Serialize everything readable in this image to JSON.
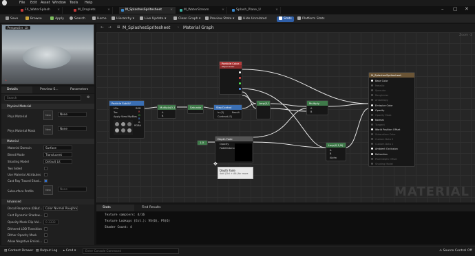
{
  "menu": [
    "File",
    "Edit",
    "Asset",
    "Window",
    "Tools",
    "Help"
  ],
  "doc_tabs": [
    {
      "label": "FX_WaterSplash",
      "color": "#c43a3a"
    },
    {
      "label": "M_Droplets",
      "color": "#c43a3a"
    },
    {
      "label": "M_SplashesSpritesheet",
      "color": "#3a8ad0"
    },
    {
      "label": "M_WaterStream",
      "color": "#3ab0a0"
    },
    {
      "label": "Splash_Plane_U",
      "color": "#3a8ad0"
    }
  ],
  "toolbar": {
    "save": "Save",
    "browse": "Browse",
    "apply": "Apply",
    "search": "Search",
    "home": "Home",
    "hierarchy": "Hierarchy",
    "live_update": "Live Update",
    "clean_graph": "Clean Graph",
    "preview_state": "Preview State",
    "hide_unrelated": "Hide Unrelated",
    "stats": "Stats",
    "platform_stats": "Platform Stats"
  },
  "viewport": {
    "perspective": "Perspective",
    "lit": "Lit"
  },
  "left_tabs": {
    "details": "Details",
    "preview": "Preview S...",
    "parameters": "Parameters"
  },
  "details": {
    "search_placeholder": "Search",
    "physical_material": "Physical Material",
    "phys_material": {
      "label": "Phys Material",
      "value": "None"
    },
    "phys_material_mask": {
      "label": "Phys Material Mask",
      "value": "None"
    },
    "material": "Material",
    "material_domain": {
      "label": "Material Domain",
      "value": "Surface"
    },
    "blend_mode": {
      "label": "Blend Mode",
      "value": "Translucent"
    },
    "shading_model": {
      "label": "Shading Model",
      "value": "Default Lit"
    },
    "two_sided": "Two Sided",
    "use_material_attributes": "Use Material Attributes",
    "cast_ray_traced": "Cast Ray Traced Shad...",
    "subsurface_profile": {
      "label": "Subsurface Profile",
      "value": "None"
    },
    "advanced": "Advanced",
    "decal_response": {
      "label": "Decal Response (DBuf...",
      "value": "Color Normal Roughness"
    },
    "cast_dynamic": "Cast Dynamic Shadow...",
    "opacity_mask_clip": {
      "label": "Opacity Mask Clip Val...",
      "value": "0.3333"
    },
    "dithered_lod": "Dithered LOD Transition",
    "dither_opacity": "Dither Opacity Mask",
    "allow_negative": "Allow Negative Emissi...",
    "thumb_label": "New"
  },
  "graph": {
    "breadcrumb_root": "M_SplashesSpritesheet",
    "breadcrumb_leaf": "Material Graph",
    "zoom": "Zoom -2",
    "watermark": "MATERIAL",
    "nodes": {
      "particle_subuv": {
        "title": "Particle SubUV",
        "pins": [
          "UVs",
          "Tex",
          "Apply View MipBias"
        ],
        "outs": [
          "RGB",
          "R",
          "G",
          "B",
          "A",
          "RGBA"
        ]
      },
      "multiply": {
        "title": "Multiply(0,1)",
        "pins": [
          "A",
          "B"
        ]
      },
      "saturate": {
        "title": "Saturate"
      },
      "step_control": {
        "title": "StepControl",
        "pins": [
          "In (S)",
          "Contrast (S)"
        ],
        "out": "Result"
      },
      "particle_color": {
        "title": "Particle Color",
        "subtitle": "Object Color"
      },
      "lerp": {
        "title": "Lerp(0,1)"
      },
      "multiply2": {
        "title": "Multiply",
        "pins": [
          "A",
          "B"
        ]
      },
      "depth_fade": {
        "title": "Depth Fade",
        "pins": [
          "Opacity",
          "FadeDistance"
        ]
      },
      "lerp2": {
        "title": "Lerp(0,1,N)",
        "pins": [
          "A",
          "B",
          "Alpha"
        ]
      },
      "one": {
        "title": "1.0"
      },
      "result": {
        "title": "M_SplashesSpritesheet",
        "pins": [
          "Base Color",
          "Metallic",
          "Specular",
          "Roughness",
          "Anisotropy",
          "Emissive Color",
          "Opacity",
          "Opacity Mask",
          "Normal",
          "Tangent",
          "World Position Offset",
          "Subsurface Color",
          "Custom Data 0",
          "Custom Data 1",
          "Ambient Occlusion",
          "Refraction",
          "Pixel Depth Offset",
          "Shading Model"
        ]
      }
    },
    "tooltip": {
      "title": "Depth Fade",
      "subtitle": "Add (Ctrl + Alt) for more"
    }
  },
  "bottom_tabs": {
    "stats": "Stats",
    "find_results": "Find Results"
  },
  "stats_lines": [
    "Texture samplers: 4/16",
    "Texture Lookups (Est.): VS(0), PS(6)",
    "Shader Count: 4"
  ],
  "status": {
    "content_drawer": "Content Drawer",
    "output_log": "Output Log",
    "cmd": "Cmd",
    "console_placeholder": "Enter Console Command",
    "source_control": "Source Control Off"
  }
}
